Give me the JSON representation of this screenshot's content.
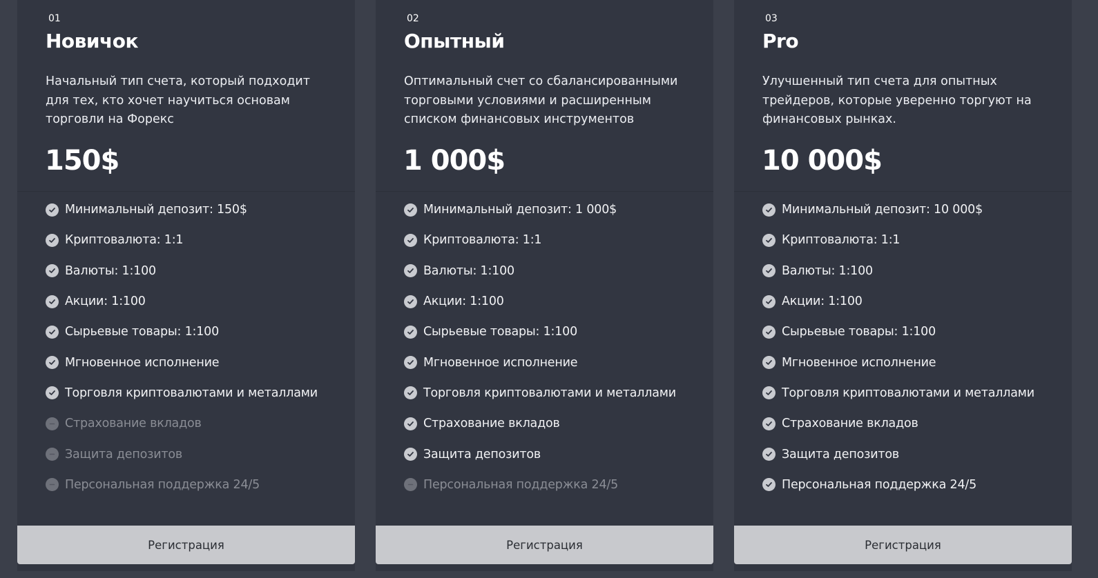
{
  "plans": [
    {
      "number": "01",
      "title": "Новичок",
      "description": "Начальный тип счета, который подходит для тех, кто хочет научиться основам торговли на Форекс",
      "price": "150$",
      "features": [
        {
          "label": "Минимальный депозит: 150$",
          "included": true
        },
        {
          "label": "Криптовалюта: 1:1",
          "included": true
        },
        {
          "label": "Валюты: 1:100",
          "included": true
        },
        {
          "label": "Акции: 1:100",
          "included": true
        },
        {
          "label": "Сырьевые товары: 1:100",
          "included": true
        },
        {
          "label": "Мгновенное исполнение",
          "included": true
        },
        {
          "label": "Торговля криптовалютами и металлами",
          "included": true
        },
        {
          "label": "Страхование вкладов",
          "included": false
        },
        {
          "label": "Защита депозитов",
          "included": false
        },
        {
          "label": "Персональная поддержка 24/5",
          "included": false
        }
      ],
      "button_label": "Регистрация"
    },
    {
      "number": "02",
      "title": "Опытный",
      "description": "Оптимальный счет со сбалансированными торговыми условиями и расширенным списком финансовых инструментов",
      "price": "1 000$",
      "features": [
        {
          "label": "Минимальный депозит: 1 000$",
          "included": true
        },
        {
          "label": "Криптовалюта: 1:1",
          "included": true
        },
        {
          "label": "Валюты: 1:100",
          "included": true
        },
        {
          "label": "Акции: 1:100",
          "included": true
        },
        {
          "label": "Сырьевые товары: 1:100",
          "included": true
        },
        {
          "label": "Мгновенное исполнение",
          "included": true
        },
        {
          "label": "Торговля криптовалютами и металлами",
          "included": true
        },
        {
          "label": "Страхование вкладов",
          "included": true
        },
        {
          "label": "Защита депозитов",
          "included": true
        },
        {
          "label": "Персональная поддержка 24/5",
          "included": false
        }
      ],
      "button_label": "Регистрация"
    },
    {
      "number": "03",
      "title": "Pro",
      "description": "Улучшенный тип счета для опытных трейдеров, которые уверенно торгуют на финансовых рынках.",
      "price": "10 000$",
      "features": [
        {
          "label": "Минимальный депозит: 10 000$",
          "included": true
        },
        {
          "label": "Криптовалюта: 1:1",
          "included": true
        },
        {
          "label": "Валюты: 1:100",
          "included": true
        },
        {
          "label": "Акции: 1:100",
          "included": true
        },
        {
          "label": "Сырьевые товары: 1:100",
          "included": true
        },
        {
          "label": "Мгновенное исполнение",
          "included": true
        },
        {
          "label": "Торговля криптовалютами и металлами",
          "included": true
        },
        {
          "label": "Страхование вкладов",
          "included": true
        },
        {
          "label": "Защита депозитов",
          "included": true
        },
        {
          "label": "Персональная поддержка 24/5",
          "included": true
        }
      ],
      "button_label": "Регистрация"
    }
  ],
  "icons": {
    "included": "check-circle-icon",
    "excluded": "minus-circle-icon"
  },
  "colors": {
    "page_background": "#3b3f4a",
    "card_background": "#323641",
    "button_background": "#c8c9cd",
    "included_icon": "#c9cbd0",
    "excluded_icon": "#6e717a",
    "excluded_text": "#8a8d95"
  }
}
